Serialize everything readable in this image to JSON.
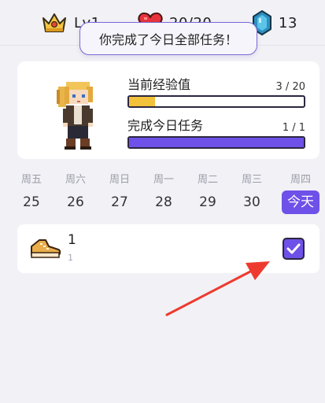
{
  "status": {
    "level": "Lv1",
    "hp": "20/20",
    "gems": "13",
    "icons": {
      "level": "crown-icon",
      "hp": "heart-icon",
      "gems": "gem-icon"
    }
  },
  "toast": {
    "message": "你完成了今日全部任务！"
  },
  "profile": {
    "xp": {
      "label": "当前经验值",
      "count": "3 / 20",
      "fraction": 0.15
    },
    "tasks": {
      "label": "完成今日任务",
      "count": "1 / 1",
      "fraction": 1.0
    }
  },
  "week": [
    {
      "weekday": "周五",
      "date": "25"
    },
    {
      "weekday": "周六",
      "date": "26"
    },
    {
      "weekday": "周日",
      "date": "27"
    },
    {
      "weekday": "周一",
      "date": "28"
    },
    {
      "weekday": "周二",
      "date": "29"
    },
    {
      "weekday": "周三",
      "date": "30"
    },
    {
      "weekday": "周四",
      "date": "今天"
    }
  ],
  "task": {
    "title": "1",
    "subtitle": "1",
    "completed": true,
    "icon": "sneaker-icon"
  },
  "colors": {
    "accent": "#6e51e8",
    "xp_bar": "#f2c23a",
    "annotation_arrow": "#ee3a2e"
  }
}
